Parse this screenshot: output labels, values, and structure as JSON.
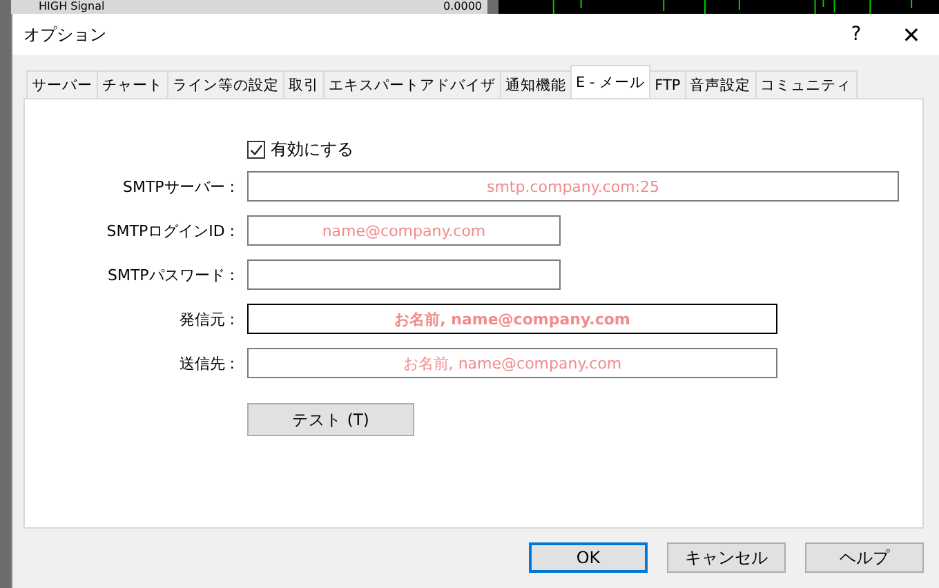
{
  "background": {
    "list_row": {
      "name": "HIGH Signal",
      "value": "0.0000"
    }
  },
  "window": {
    "title": "オプション",
    "help": "?",
    "close": "✕"
  },
  "tabs": [
    {
      "label": "サーバー",
      "selected": false
    },
    {
      "label": "チャート",
      "selected": false
    },
    {
      "label": "ライン等の設定",
      "selected": false
    },
    {
      "label": "取引",
      "selected": false
    },
    {
      "label": "エキスパートアドバイザ",
      "selected": false
    },
    {
      "label": "通知機能",
      "selected": false
    },
    {
      "label": "E - メール",
      "selected": true
    },
    {
      "label": "FTP",
      "selected": false
    },
    {
      "label": "音声設定",
      "selected": false
    },
    {
      "label": "コミュニティ",
      "selected": false
    }
  ],
  "enable": {
    "label": "有効にする",
    "checked": true
  },
  "fields": [
    {
      "label": "SMTPサーバー :",
      "placeholder": "smtp.company.com:25",
      "focused": false
    },
    {
      "label": "SMTPログインID :",
      "placeholder": "name@company.com",
      "focused": false
    },
    {
      "label": "SMTPパスワード :",
      "focused": false
    },
    {
      "label": "発信元 :",
      "placeholder": "お名前, name@company.com",
      "focused": true
    },
    {
      "label": "送信先 :",
      "placeholder": "お名前, name@company.com",
      "focused": false
    }
  ],
  "test_button": "テスト (T)",
  "buttons": [
    {
      "label": "OK",
      "default": true
    },
    {
      "label": "キャンセル",
      "default": false
    },
    {
      "label": "ヘルプ",
      "default": false
    }
  ]
}
